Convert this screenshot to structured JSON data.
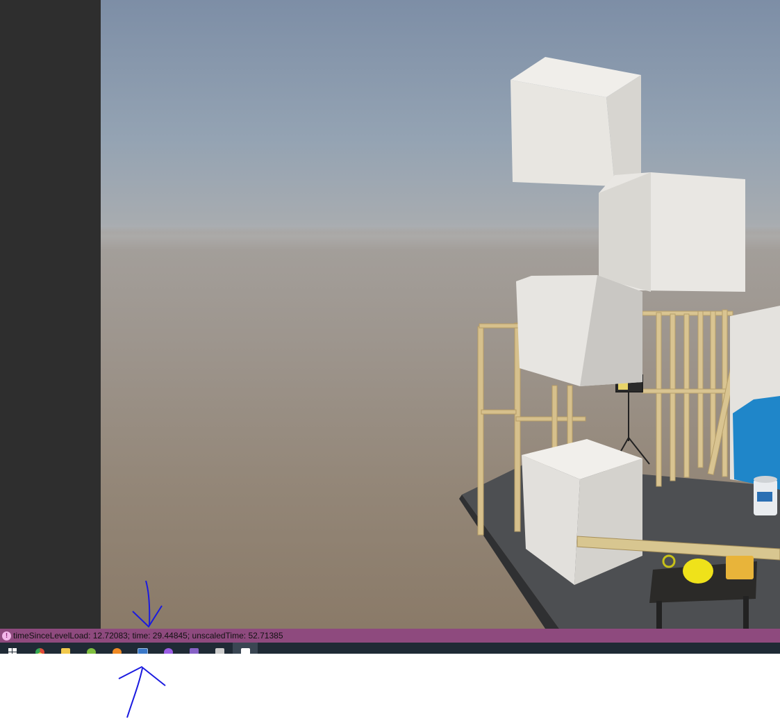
{
  "console": {
    "icon": "warning-icon",
    "message": "timeSinceLevelLoad: 12.72083; time: 29.44845; unscaledTime: 52.71385"
  },
  "taskbar": {
    "items": [
      {
        "icon": "windows-start-icon",
        "color": "#ffffff"
      },
      {
        "icon": "chrome-icon",
        "color": "#e04a3a"
      },
      {
        "icon": "file-explorer-icon",
        "color": "#f2c94c"
      },
      {
        "icon": "app-icon",
        "color": "#7fbf3f"
      },
      {
        "icon": "blender-icon",
        "color": "#f08a24"
      },
      {
        "icon": "terminal-icon",
        "color": "#3a78c8"
      },
      {
        "icon": "app-purple-icon",
        "color": "#9b5de5"
      },
      {
        "icon": "visual-studio-icon",
        "color": "#8661c5"
      },
      {
        "icon": "unity-icon",
        "color": "#cccccc"
      },
      {
        "icon": "unity-active-icon",
        "color": "#ffffff"
      }
    ]
  },
  "colors": {
    "left_panel": "#2e2e2e",
    "console_bar": "#8e4a7e",
    "taskbar": "#1f2a35",
    "annotation": "#1a1ae0"
  }
}
